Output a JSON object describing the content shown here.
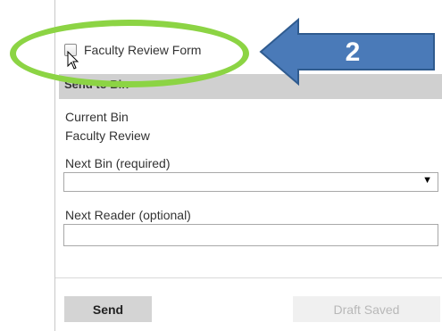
{
  "form": {
    "checkbox_label": "Faculty Review Form",
    "checkbox_checked": false
  },
  "section": {
    "title": "Send to Bin"
  },
  "current_bin": {
    "label": "Current Bin",
    "value": "Faculty Review"
  },
  "next_bin": {
    "label": "Next Bin (required)",
    "selected_value": ""
  },
  "next_reader": {
    "label": "Next Reader (optional)",
    "value": ""
  },
  "actions": {
    "send_label": "Send",
    "draft_label": "Draft Saved"
  },
  "callout": {
    "number": "2",
    "arrow_color": "#4a7ab8",
    "highlight_color": "#8cd444"
  }
}
